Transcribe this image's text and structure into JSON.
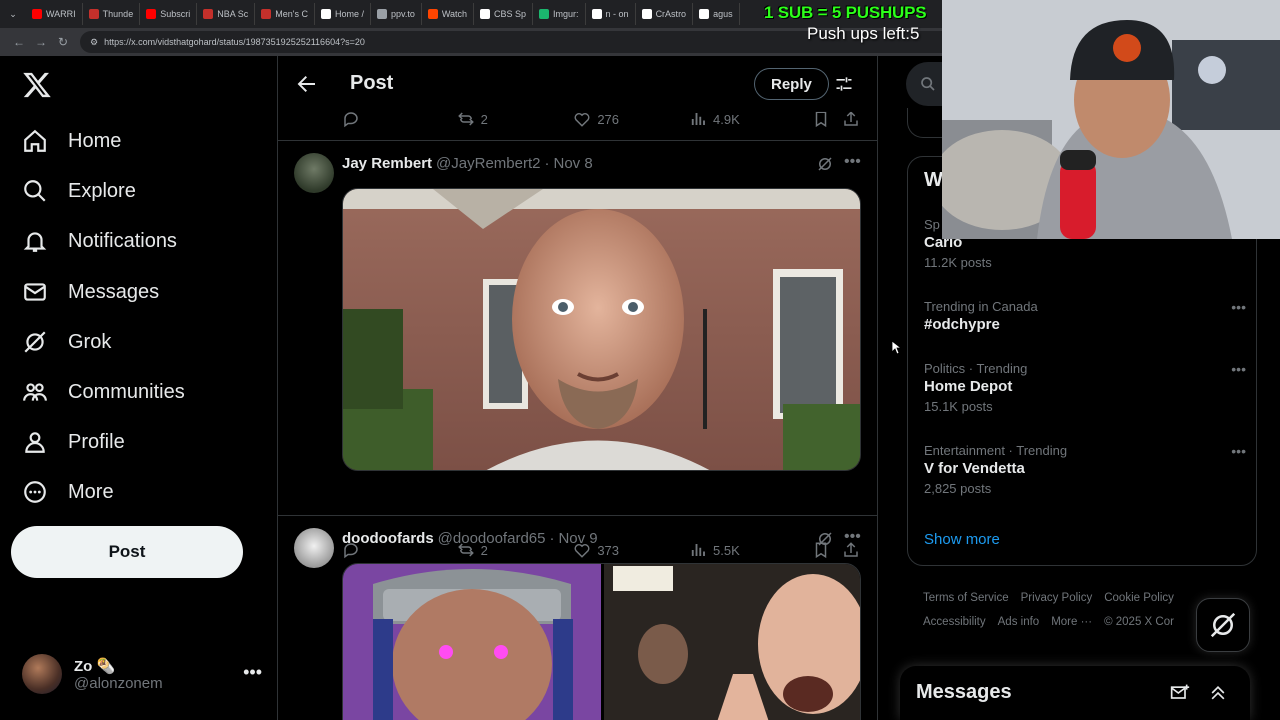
{
  "browser": {
    "tabs": [
      {
        "label": "WARRI",
        "color": "#ff0000"
      },
      {
        "label": "Thunde",
        "color": "#c4302b"
      },
      {
        "label": "Subscri",
        "color": "#ff0000"
      },
      {
        "label": "NBA Sc",
        "color": "#c4302b"
      },
      {
        "label": "Men's C",
        "color": "#c4302b"
      },
      {
        "label": "Home /",
        "color": "#ffffff"
      },
      {
        "label": "ppv.to",
        "color": "#9aa0a6"
      },
      {
        "label": "Watch",
        "color": "#ff4500"
      },
      {
        "label": "CBS Sp",
        "color": "#ffffff"
      },
      {
        "label": "Imgur:",
        "color": "#1bb76e"
      },
      {
        "label": "n - on",
        "color": "#ffffff"
      },
      {
        "label": "CrAstro",
        "color": "#ffffff"
      },
      {
        "label": "agus",
        "color": "#ffffff"
      }
    ],
    "url": "https://x.com/vidsthatgohard/status/1987351925252116604?s=20"
  },
  "overlay": {
    "sub_text": "1 SUB = 5 PUSHUPS",
    "pushups_text": "Push ups left:5"
  },
  "nav": {
    "items": [
      {
        "label": "Home",
        "icon": "home-icon"
      },
      {
        "label": "Explore",
        "icon": "search-icon"
      },
      {
        "label": "Notifications",
        "icon": "bell-icon"
      },
      {
        "label": "Messages",
        "icon": "envelope-icon"
      },
      {
        "label": "Grok",
        "icon": "grok-icon"
      },
      {
        "label": "Communities",
        "icon": "people-icon"
      },
      {
        "label": "Profile",
        "icon": "person-icon"
      },
      {
        "label": "More",
        "icon": "more-circle-icon"
      }
    ],
    "post_label": "Post"
  },
  "account": {
    "name": "Zo",
    "emoji": "🌯",
    "handle": "@alonzonem"
  },
  "header": {
    "title": "Post",
    "reply_label": "Reply"
  },
  "top_actions": {
    "replies": "",
    "reposts": "2",
    "likes": "276",
    "views": "4.9K"
  },
  "tweets": [
    {
      "name": "Jay Rembert",
      "handle": "@JayRembert2",
      "date": "Nov 8",
      "actions": {
        "replies": "",
        "reposts": "2",
        "likes": "373",
        "views": "5.5K"
      }
    },
    {
      "name": "doodoofards",
      "handle": "@doodoofard65",
      "date": "Nov 9"
    }
  ],
  "trends": {
    "heading": "W",
    "items": [
      {
        "category": "Sp",
        "name": "Carlo",
        "count": "11.2K posts"
      },
      {
        "category": "Trending in Canada",
        "name": "#odchypre",
        "count": ""
      },
      {
        "category": "Politics · Trending",
        "name": "Home Depot",
        "count": "15.1K posts"
      },
      {
        "category": "Entertainment · Trending",
        "name": "V for Vendetta",
        "count": "2,825 posts"
      }
    ],
    "show_more": "Show more"
  },
  "footer": {
    "links": [
      "Terms of Service",
      "Privacy Policy",
      "Cookie Policy",
      "Accessibility",
      "Ads info",
      "More ···",
      "© 2025 X Cor"
    ]
  },
  "messages": {
    "title": "Messages"
  }
}
